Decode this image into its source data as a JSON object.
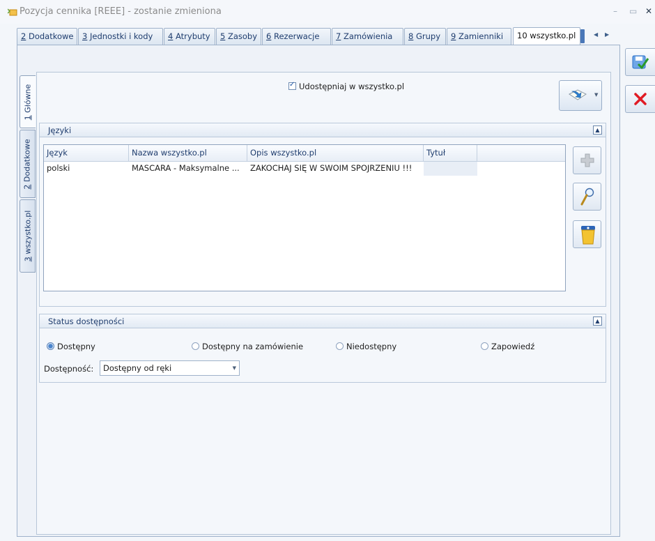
{
  "window": {
    "title": "Pozycja cennika [REEE] - zostanie zmieniona",
    "minimize_glyph": "–",
    "maximize_glyph": "▭",
    "close_glyph": "✕"
  },
  "tabs": [
    {
      "num": "2",
      "label": " Dodatkowe"
    },
    {
      "num": "3",
      "label": " Jednostki i kody"
    },
    {
      "num": "4",
      "label": " Atrybuty"
    },
    {
      "num": "5",
      "label": " Zasoby"
    },
    {
      "num": "6",
      "label": " Rezerwacje"
    },
    {
      "num": "7",
      "label": " Zamówienia"
    },
    {
      "num": "8",
      "label": " Grupy"
    },
    {
      "num": "9",
      "label": " Zamienniki"
    },
    {
      "num": "",
      "label": "10 wszystko.pl"
    }
  ],
  "vertical_tabs": [
    {
      "num": "1",
      "label": " Główne"
    },
    {
      "num": "2",
      "label": " Dodatkowe"
    },
    {
      "num": "3",
      "label": " wszystko.pl"
    }
  ],
  "share": {
    "label": "Udostępniaj w wszystko.pl",
    "checked": true
  },
  "languages": {
    "title": "Języki",
    "columns": [
      "Język",
      "Nazwa wszystko.pl",
      "Opis wszystko.pl",
      "Tytuł"
    ],
    "rows": [
      [
        "polski",
        "MASCARA - Maksymalne ...",
        "ZAKOCHAJ SIĘ W SWOIM SPOJRZENIU !!!",
        ""
      ]
    ]
  },
  "availability": {
    "title": "Status dostępności",
    "options": [
      "Dostępny",
      "Dostępny na zamówienie",
      "Niedostępny",
      "Zapowiedź"
    ],
    "selected": "Dostępny",
    "field_label": "Dostępność:",
    "field_value": "Dostępny od ręki"
  },
  "icons": {
    "app": "price-list-icon",
    "tool": "template-arrow-icon",
    "add": "plus-icon",
    "edit": "magnifier-icon",
    "delete": "trash-can-icon",
    "save": "save-icon",
    "cancel": "close-icon"
  },
  "colors": {
    "accent": "#1f3d6e",
    "cancel": "#e01b24",
    "save": "#2a6fc9"
  }
}
